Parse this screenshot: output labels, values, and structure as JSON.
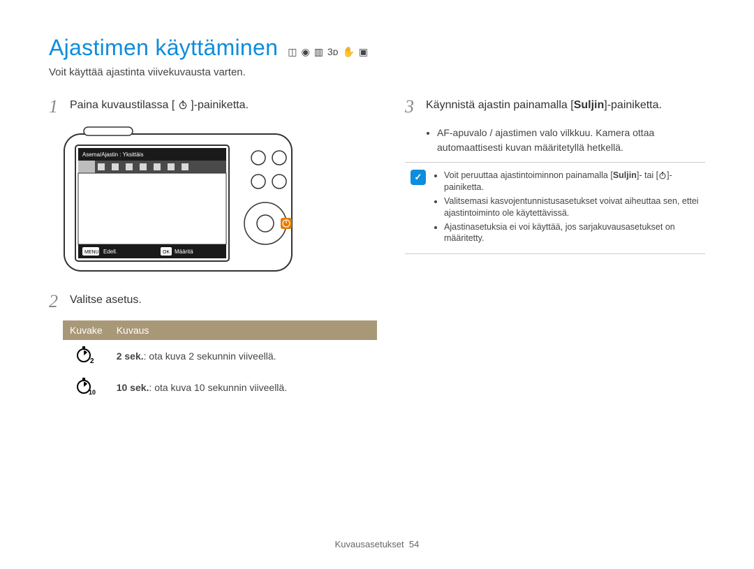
{
  "title": "Ajastimen käyttäminen",
  "mode_icons": [
    "smart-auto-icon",
    "program-icon",
    "scene-icon",
    "3d-icon",
    "movie-icon",
    "dual-is-icon"
  ],
  "subtitle": "Voit käyttää ajastinta viivekuvausta varten.",
  "left": {
    "step1": {
      "num": "1",
      "text_pre": "Paina kuvaustilassa [",
      "icon": "timer-button-icon",
      "text_post": "]-painiketta."
    },
    "lcd": {
      "topbar": "Asema/Ajastin : Yksittäis",
      "bottom_left_btn": "MENU",
      "bottom_left_label": "Edell.",
      "bottom_right_btn": "OK",
      "bottom_right_label": "Määritä"
    },
    "step2": {
      "num": "2",
      "text": "Valitse asetus."
    },
    "table": {
      "headers": [
        "Kuvake",
        "Kuvaus"
      ],
      "rows": [
        {
          "icon": "timer-2s-icon",
          "label_bold": "2 sek.",
          "label_rest": ": ota kuva 2 sekunnin viiveellä."
        },
        {
          "icon": "timer-10s-icon",
          "label_bold": "10 sek.",
          "label_rest": ": ota kuva 10 sekunnin viiveellä."
        }
      ]
    }
  },
  "right": {
    "step3": {
      "num": "3",
      "text_pre": "Käynnistä ajastin painamalla [",
      "bold": "Suljin",
      "text_post": "]-painiketta."
    },
    "sub1": "AF-apuvalo / ajastimen valo vilkkuu. Kamera ottaa automaattisesti kuvan määritetyllä hetkellä.",
    "info": {
      "items": [
        {
          "pre": "Voit peruuttaa ajastintoiminnon painamalla [",
          "bold": "Suljin",
          "mid": "]- tai [",
          "icon": "timer-button-icon",
          "post": "]-painiketta."
        },
        {
          "text": "Valitsemasi kasvojentunnistusasetukset voivat aiheuttaa sen, ettei ajastintoiminto ole käytettävissä."
        },
        {
          "text": "Ajastinasetuksia ei voi käyttää, jos sarjakuvausasetukset on määritetty."
        }
      ]
    }
  },
  "footer": {
    "section": "Kuvausasetukset",
    "page": "54"
  }
}
